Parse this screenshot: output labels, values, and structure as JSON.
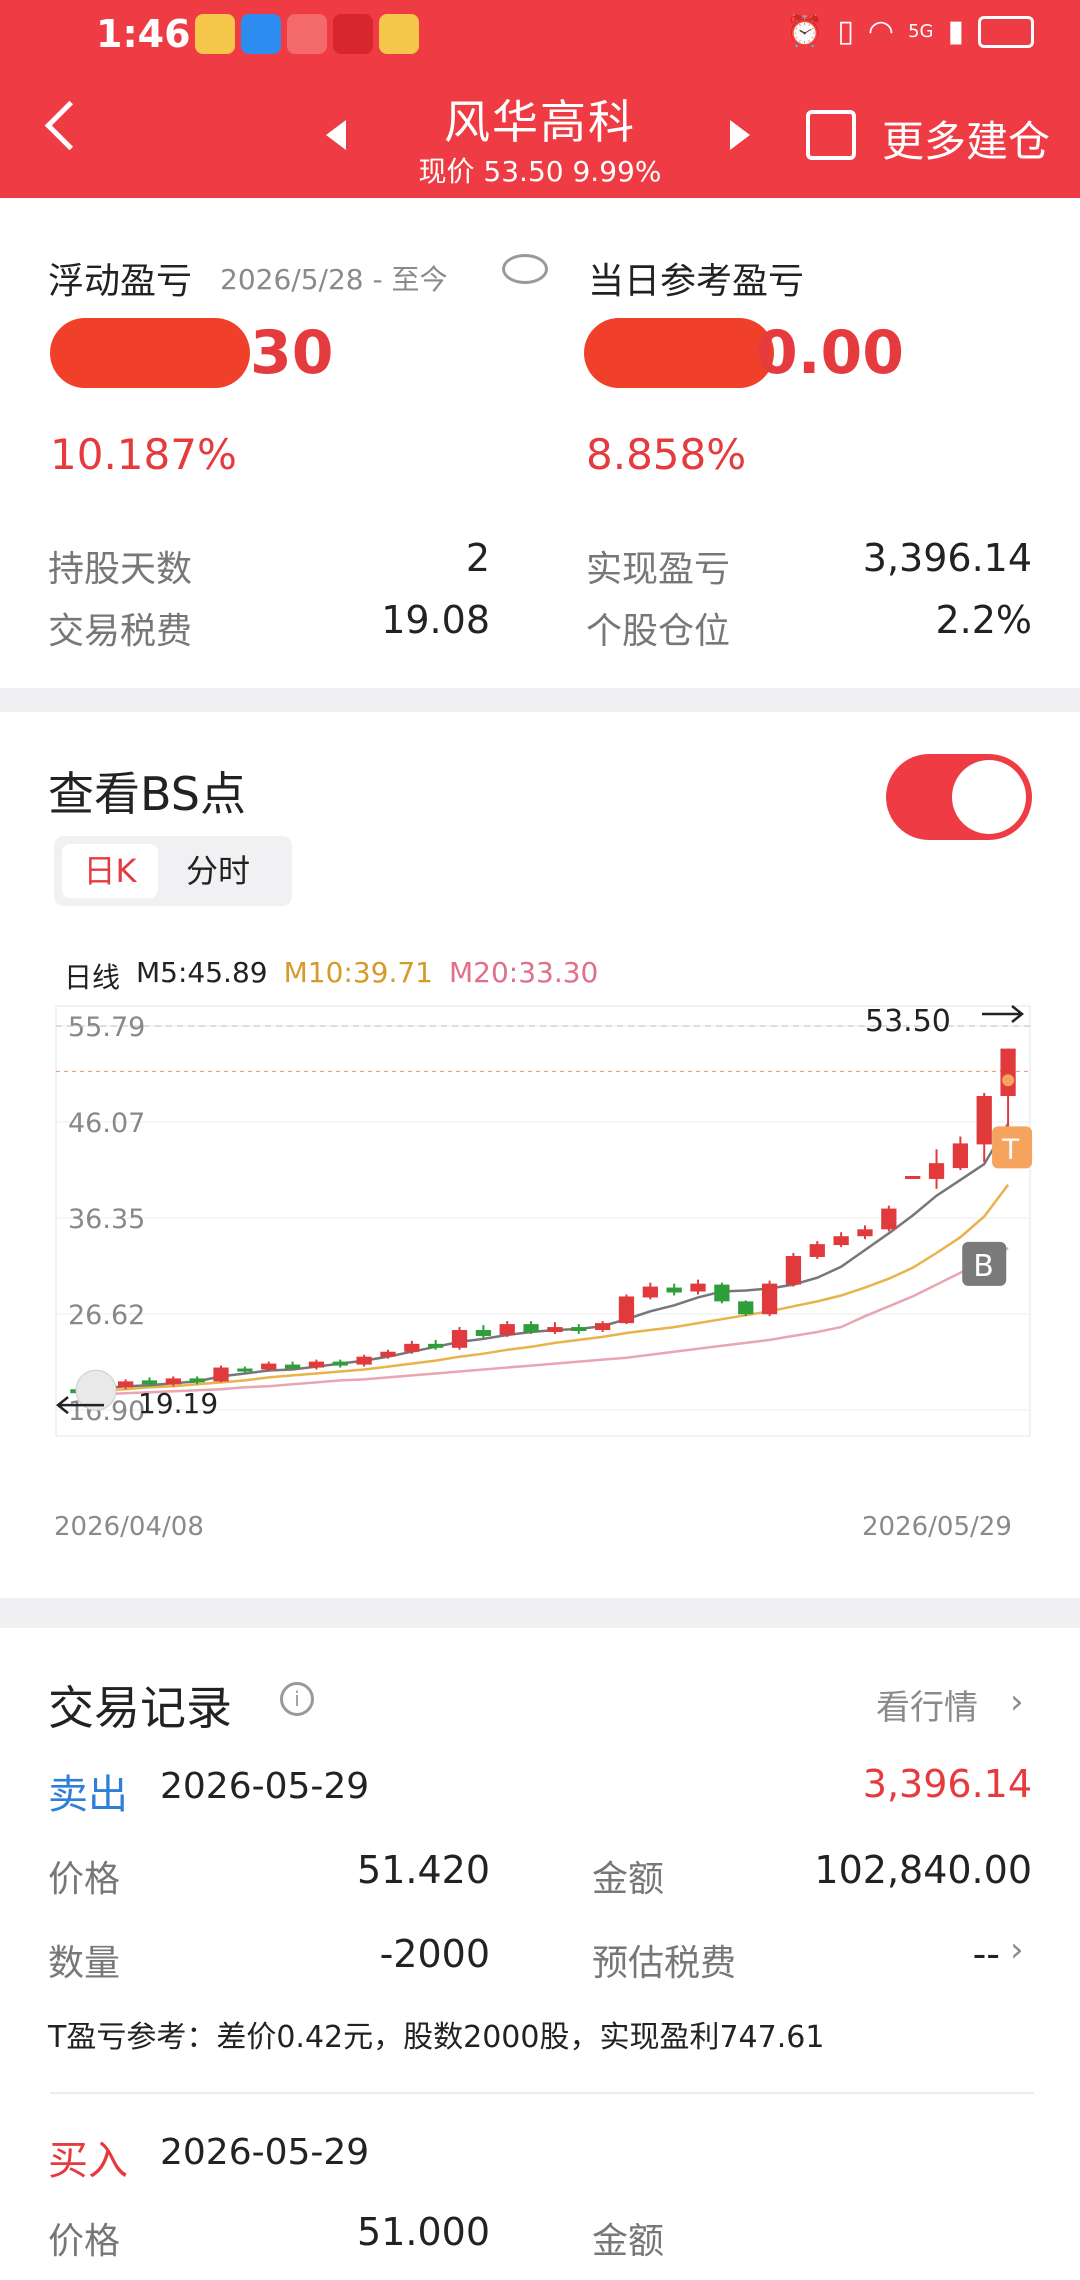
{
  "status_bar": {
    "time": "1:46",
    "right": "5G"
  },
  "header": {
    "title": "风华高科",
    "subtitle": "现价 53.50 9.99%",
    "more_label": "更多建仓"
  },
  "pnl": {
    "float_label": "浮动盈亏",
    "float_range": "2026/5/28 - 至今",
    "float_value_tail": "30",
    "float_pct": "10.187%",
    "day_label": "当日参考盈亏",
    "day_value_tail": "0.00",
    "day_pct": "8.858%",
    "rows": [
      {
        "label": "持股天数",
        "value": "2",
        "label2": "实现盈亏",
        "value2": "3,396.14"
      },
      {
        "label": "交易税费",
        "value": "19.08",
        "label2": "个股仓位",
        "value2": "2.2%"
      }
    ]
  },
  "bs": {
    "title": "查看BS点",
    "tab_k": "日K",
    "tab_min": "分时",
    "legend_prefix": "日线",
    "m5": "M5:45.89",
    "m10": "M10:39.71",
    "m20": "M20:33.30",
    "last_price": "53.50",
    "low_label": "19.19",
    "date_start": "2026/04/08",
    "date_end": "2026/05/29",
    "marker_b": "B",
    "marker_t": "T",
    "colors": {
      "up": "#e03a3c",
      "down": "#2e9e3a",
      "m5": "#777777",
      "m10": "#e8b34a",
      "m20": "#e9a6b2"
    }
  },
  "chart_data": {
    "type": "candlestick",
    "y_ticks": [
      "55.79",
      "46.07",
      "36.35",
      "26.62",
      "16.90"
    ],
    "ylim": [
      16.9,
      55.79
    ],
    "x_start": "2026/04/08",
    "x_end": "2026/05/29",
    "last": 53.5,
    "candles": [
      [
        19.0,
        18.6,
        19.3,
        18.4
      ],
      [
        18.6,
        19.3,
        19.5,
        18.4
      ],
      [
        19.2,
        19.8,
        20.0,
        19.0
      ],
      [
        19.9,
        19.5,
        20.2,
        19.3
      ],
      [
        19.5,
        20.1,
        20.3,
        19.3
      ],
      [
        20.1,
        19.7,
        20.3,
        19.5
      ],
      [
        19.8,
        21.2,
        21.4,
        19.7
      ],
      [
        21.1,
        20.9,
        21.3,
        20.7
      ],
      [
        21.0,
        21.6,
        21.8,
        20.8
      ],
      [
        21.5,
        21.1,
        21.8,
        21.0
      ],
      [
        21.2,
        21.8,
        22.0,
        21.0
      ],
      [
        21.8,
        21.4,
        22.0,
        21.2
      ],
      [
        21.5,
        22.3,
        22.5,
        21.3
      ],
      [
        22.3,
        22.8,
        23.0,
        22.1
      ],
      [
        22.8,
        23.6,
        23.9,
        22.6
      ],
      [
        23.6,
        23.2,
        24.0,
        23.0
      ],
      [
        23.2,
        25.0,
        25.3,
        23.0
      ],
      [
        25.0,
        24.4,
        25.5,
        24.1
      ],
      [
        24.5,
        25.6,
        25.9,
        24.3
      ],
      [
        25.6,
        24.8,
        25.9,
        24.6
      ],
      [
        24.8,
        25.3,
        25.8,
        24.6
      ],
      [
        25.3,
        24.9,
        25.6,
        24.6
      ],
      [
        25.0,
        25.7,
        25.9,
        24.8
      ],
      [
        25.7,
        28.4,
        28.6,
        25.6
      ],
      [
        28.3,
        29.4,
        29.8,
        28.1
      ],
      [
        29.3,
        28.8,
        29.7,
        28.5
      ],
      [
        28.9,
        29.7,
        30.1,
        28.6
      ],
      [
        29.6,
        27.9,
        29.8,
        27.7
      ],
      [
        27.9,
        26.6,
        28.0,
        26.4
      ],
      [
        26.6,
        29.7,
        30.0,
        26.4
      ],
      [
        29.6,
        32.5,
        32.8,
        29.4
      ],
      [
        32.4,
        33.7,
        34.0,
        32.2
      ],
      [
        33.6,
        34.5,
        34.9,
        33.4
      ],
      [
        34.5,
        35.2,
        35.6,
        34.2
      ],
      [
        35.2,
        37.3,
        37.6,
        35.0
      ],
      [
        40.6,
        40.6,
        40.6,
        40.6
      ],
      [
        40.3,
        41.9,
        43.3,
        39.3
      ],
      [
        41.4,
        43.9,
        44.6,
        41.2
      ],
      [
        43.8,
        48.7,
        49.0,
        42.0
      ],
      [
        48.7,
        53.5,
        53.5,
        44.6
      ]
    ],
    "m5": [
      18.9,
      19.1,
      19.3,
      19.4,
      19.6,
      19.8,
      20.3,
      20.6,
      20.9,
      21.0,
      21.3,
      21.6,
      21.9,
      22.3,
      22.8,
      23.3,
      23.8,
      24.1,
      24.5,
      24.8,
      25.0,
      25.1,
      25.4,
      26.1,
      26.9,
      27.5,
      28.3,
      28.9,
      29.0,
      29.2,
      29.6,
      30.3,
      31.4,
      33.1,
      34.8,
      36.6,
      38.6,
      40.2,
      41.8,
      45.89
    ],
    "m10": [
      18.7,
      18.9,
      19.0,
      19.2,
      19.3,
      19.5,
      19.7,
      19.9,
      20.2,
      20.4,
      20.6,
      20.8,
      21.0,
      21.3,
      21.6,
      21.9,
      22.3,
      22.6,
      23.0,
      23.3,
      23.7,
      24.0,
      24.3,
      24.7,
      25.0,
      25.3,
      25.7,
      26.1,
      26.5,
      26.9,
      27.4,
      27.9,
      28.5,
      29.3,
      30.2,
      31.3,
      32.8,
      34.4,
      36.5,
      39.71
    ],
    "m20": [
      18.4,
      18.5,
      18.6,
      18.7,
      18.8,
      18.9,
      19.0,
      19.2,
      19.3,
      19.5,
      19.7,
      19.9,
      20.0,
      20.2,
      20.4,
      20.6,
      20.8,
      21.0,
      21.2,
      21.4,
      21.6,
      21.8,
      22.0,
      22.2,
      22.5,
      22.8,
      23.1,
      23.4,
      23.7,
      24.0,
      24.4,
      24.8,
      25.3,
      26.4,
      27.4,
      28.4,
      29.6,
      30.8,
      32.0,
      33.3
    ]
  },
  "records": {
    "title": "交易记录",
    "view_quote": "看行情",
    "sell": {
      "type": "卖出",
      "date": "2026-05-29",
      "profit": "3,396.14",
      "price_label": "价格",
      "price": "51.420",
      "amount_label": "金额",
      "amount": "102,840.00",
      "qty_label": "数量",
      "qty": "-2000",
      "tax_label": "预估税费",
      "tax": "--",
      "note": "T盈亏参考：差价0.42元，股数2000股，实现盈利747.61"
    },
    "buy": {
      "type": "买入",
      "date": "2026-05-29",
      "price_label": "价格",
      "price": "51.000",
      "amount_label": "金额"
    }
  }
}
